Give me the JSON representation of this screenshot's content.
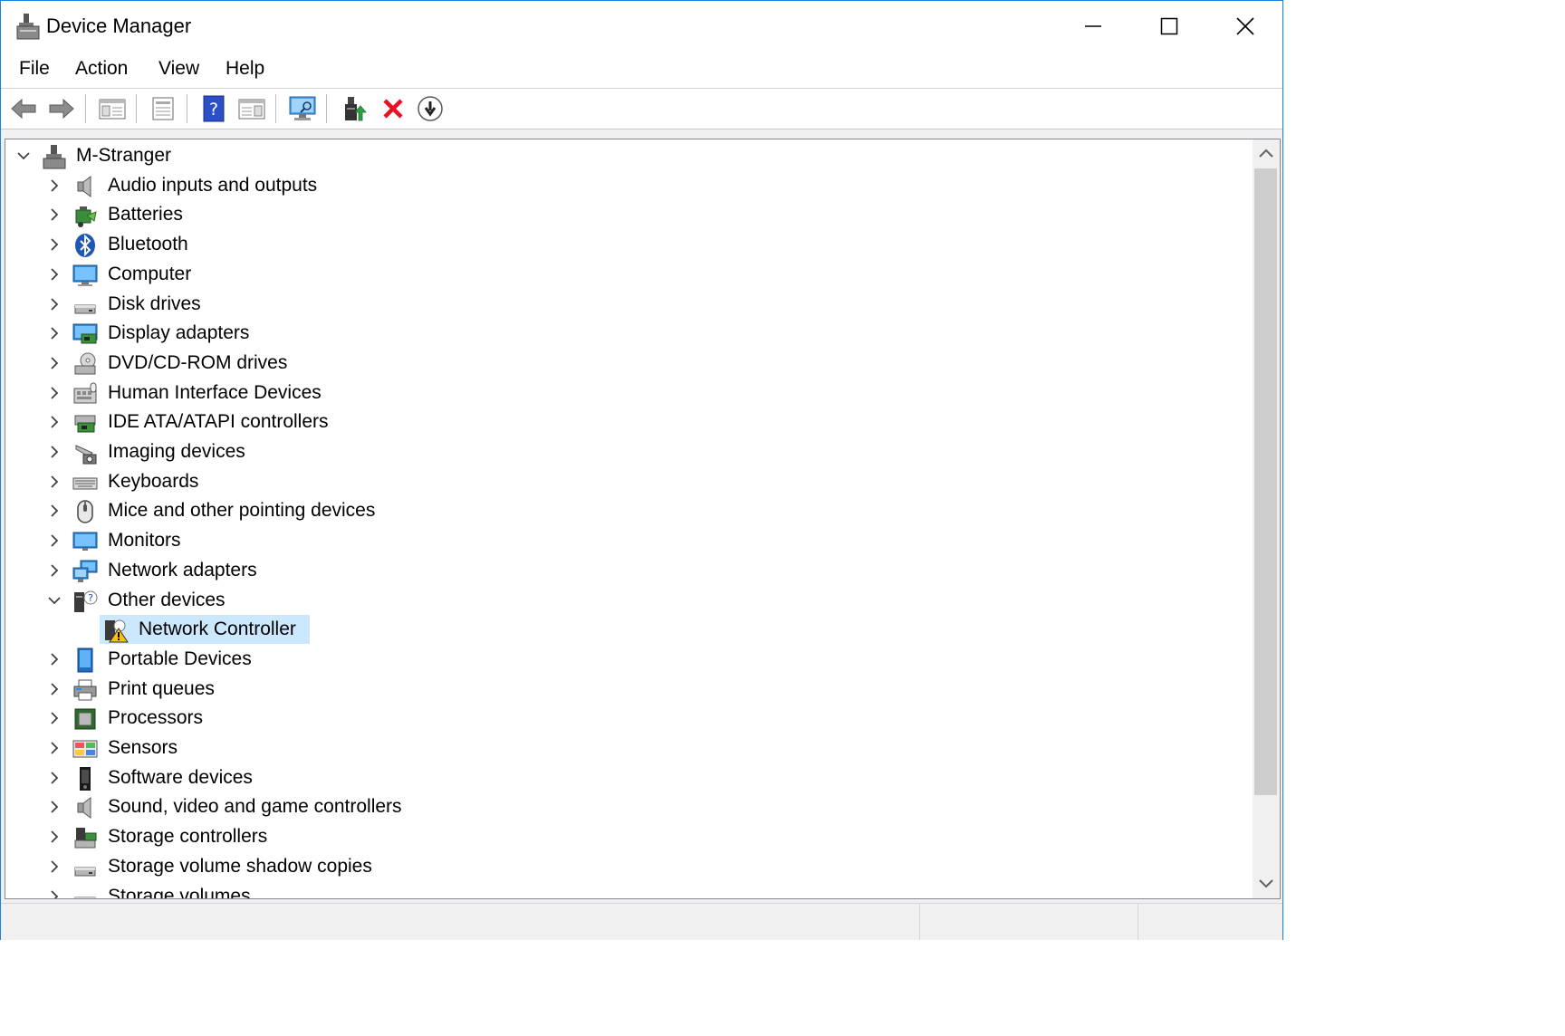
{
  "window": {
    "title": "Device Manager"
  },
  "menu": [
    "File",
    "Action",
    "View",
    "Help"
  ],
  "toolbar": [
    "back",
    "forward",
    "show-hide-console-tree",
    "properties",
    "help",
    "action-pane",
    "scan-hardware-changes",
    "update-driver",
    "uninstall-device",
    "disable-device"
  ],
  "tree": {
    "root": "M-Stranger",
    "items": [
      {
        "label": "Audio inputs and outputs",
        "icon": "speaker-icon",
        "expanded": false,
        "child": false
      },
      {
        "label": "Batteries",
        "icon": "battery-icon",
        "expanded": false,
        "child": false
      },
      {
        "label": "Bluetooth",
        "icon": "bluetooth-icon",
        "expanded": false,
        "child": false
      },
      {
        "label": "Computer",
        "icon": "computer-icon",
        "expanded": false,
        "child": false
      },
      {
        "label": "Disk drives",
        "icon": "disk-drive-icon",
        "expanded": false,
        "child": false
      },
      {
        "label": "Display adapters",
        "icon": "display-adapter-icon",
        "expanded": false,
        "child": false
      },
      {
        "label": "DVD/CD-ROM drives",
        "icon": "dvd-drive-icon",
        "expanded": false,
        "child": false
      },
      {
        "label": "Human Interface Devices",
        "icon": "hid-icon",
        "expanded": false,
        "child": false
      },
      {
        "label": "IDE ATA/ATAPI controllers",
        "icon": "ide-controller-icon",
        "expanded": false,
        "child": false
      },
      {
        "label": "Imaging devices",
        "icon": "camera-icon",
        "expanded": false,
        "child": false
      },
      {
        "label": "Keyboards",
        "icon": "keyboard-icon",
        "expanded": false,
        "child": false
      },
      {
        "label": "Mice and other pointing devices",
        "icon": "mouse-icon",
        "expanded": false,
        "child": false
      },
      {
        "label": "Monitors",
        "icon": "monitor-icon",
        "expanded": false,
        "child": false
      },
      {
        "label": "Network adapters",
        "icon": "network-adapter-icon",
        "expanded": false,
        "child": false
      },
      {
        "label": "Other devices",
        "icon": "unknown-device-icon",
        "expanded": true,
        "child": false
      },
      {
        "label": "Network Controller",
        "icon": "warning-device-icon",
        "expanded": false,
        "child": true,
        "selected": true
      },
      {
        "label": "Portable Devices",
        "icon": "portable-device-icon",
        "expanded": false,
        "child": false
      },
      {
        "label": "Print queues",
        "icon": "printer-icon",
        "expanded": false,
        "child": false
      },
      {
        "label": "Processors",
        "icon": "processor-icon",
        "expanded": false,
        "child": false
      },
      {
        "label": "Sensors",
        "icon": "sensor-icon",
        "expanded": false,
        "child": false
      },
      {
        "label": "Software devices",
        "icon": "software-device-icon",
        "expanded": false,
        "child": false
      },
      {
        "label": "Sound, video and game controllers",
        "icon": "speaker-icon",
        "expanded": false,
        "child": false
      },
      {
        "label": "Storage controllers",
        "icon": "storage-controller-icon",
        "expanded": false,
        "child": false
      },
      {
        "label": "Storage volume shadow copies",
        "icon": "disk-drive-icon",
        "expanded": false,
        "child": false
      },
      {
        "label": "Storage volumes",
        "icon": "disk-drive-icon",
        "expanded": false,
        "child": false
      }
    ]
  },
  "colors": {
    "selection": "#cce8ff",
    "accent": "#1883d7",
    "delete_red": "#e81123"
  }
}
